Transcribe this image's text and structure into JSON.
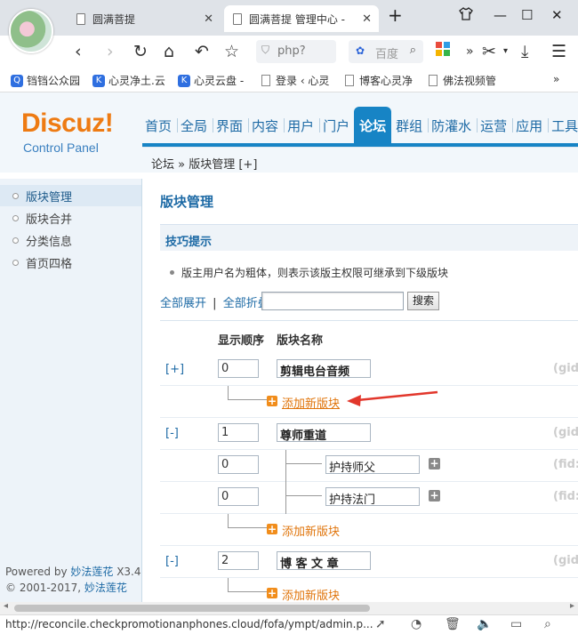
{
  "browser": {
    "tabs": [
      {
        "title": "圆满菩提"
      },
      {
        "title": "圆满菩提 管理中心 - "
      }
    ],
    "address_text": "php?",
    "search_placeholder": "百度",
    "bookmarks": [
      {
        "label": "铛铛公众园"
      },
      {
        "label": "心灵净土.云"
      },
      {
        "label": "心灵云盘 -"
      },
      {
        "label": "登录 ‹ 心灵"
      },
      {
        "label": "博客心灵净"
      },
      {
        "label": "佛法视频管"
      }
    ],
    "status_url": "http://reconcile.checkpromotionanphones.cloud/fofa/ympt/admin.p..."
  },
  "header": {
    "logo": "Discuz!",
    "logo_sub": "Control Panel",
    "nav": [
      "首页",
      "全局",
      "界面",
      "内容",
      "用户",
      "门户",
      "论坛",
      "群组",
      "防灌水",
      "运营",
      "应用",
      "工具"
    ],
    "active_nav": "论坛",
    "breadcrumb": "论坛 » 版块管理  [+]"
  },
  "sidebar": {
    "items": [
      {
        "label": "版块管理",
        "active": true
      },
      {
        "label": "版块合并",
        "active": false
      },
      {
        "label": "分类信息",
        "active": false
      },
      {
        "label": "首页四格",
        "active": false
      }
    ],
    "powered_prefix": "Powered by ",
    "powered_link": "妙法莲花",
    "powered_version": " X3.4",
    "copyright_prefix": "© 2001-2017, ",
    "copyright_link": "妙法莲花"
  },
  "main": {
    "title": "版块管理",
    "tips_title": "技巧提示",
    "tip": "版主用户名为粗体，则表示该版主权限可继承到下级版块",
    "expand_all": "全部展开",
    "separator": "|",
    "collapse_all": "全部折叠",
    "search_button": "搜索",
    "col_order": "显示顺序",
    "col_name": "版块名称",
    "add_board": "添加新版块",
    "groups": [
      {
        "toggle": "[+]",
        "order": "0",
        "name": "剪辑电台音频",
        "gid": "(gid:"
      },
      {
        "toggle": "[-]",
        "order": "1",
        "name": "尊师重道",
        "gid": "(gid:",
        "children": [
          {
            "order": "0",
            "name": "护持师父",
            "fid": "(fid:"
          },
          {
            "order": "0",
            "name": "护持法门",
            "fid": "(fid:"
          }
        ]
      },
      {
        "toggle": "[-]",
        "order": "2",
        "name": "博 客 文 章",
        "gid": "(gid:"
      }
    ]
  }
}
